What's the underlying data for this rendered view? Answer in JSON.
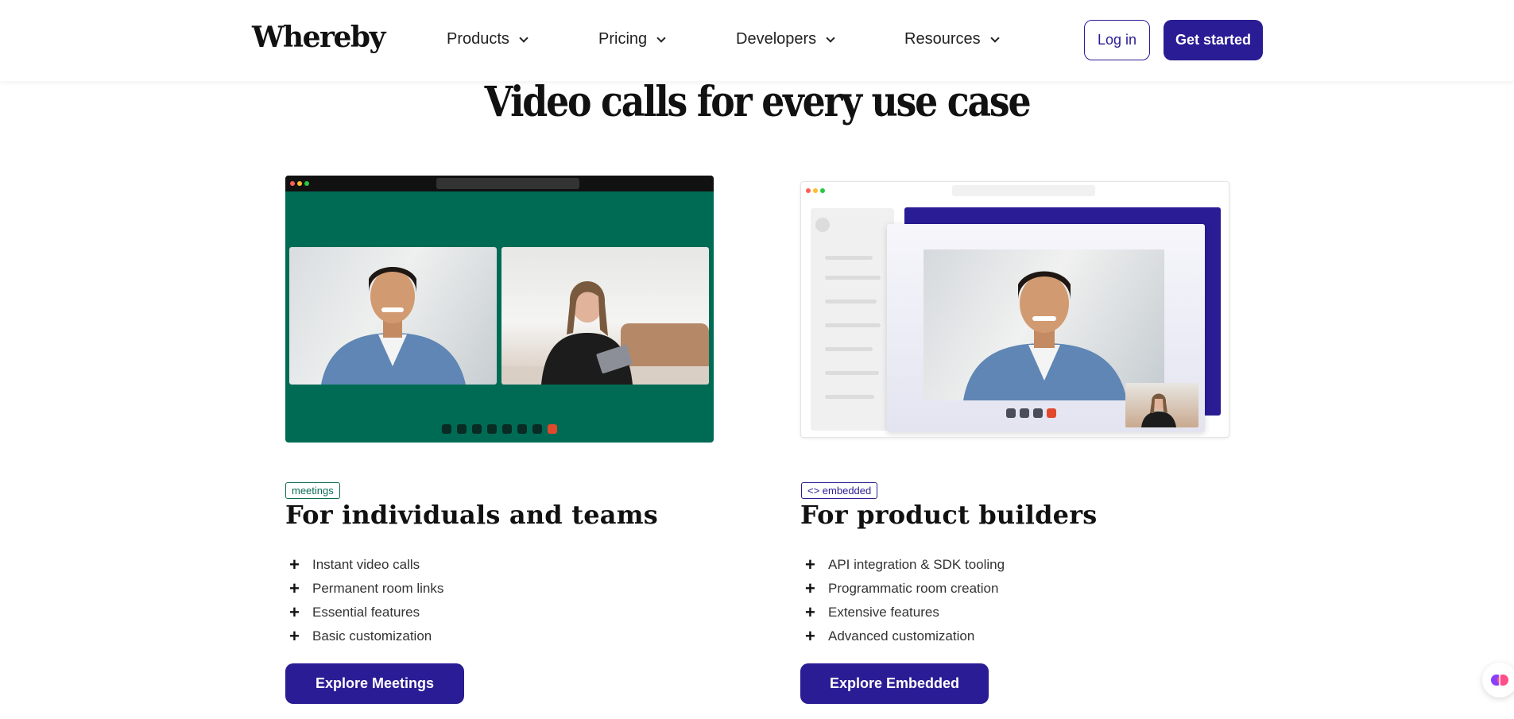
{
  "nav": {
    "logo": "Whereby",
    "items": [
      {
        "label": "Products"
      },
      {
        "label": "Pricing"
      },
      {
        "label": "Developers"
      },
      {
        "label": "Resources"
      }
    ],
    "login_label": "Log in",
    "get_started_label": "Get started"
  },
  "heading": "Video calls for every use case",
  "cards": [
    {
      "tag": "meetings",
      "title": "For individuals and teams",
      "features": [
        "Instant video calls",
        "Permanent room links",
        "Essential features",
        "Basic customization"
      ],
      "cta": "Explore Meetings"
    },
    {
      "tag": "<> embedded",
      "title": "For product builders",
      "features": [
        "API integration & SDK tooling",
        "Programmatic room creation",
        "Extensive features",
        "Advanced customization"
      ],
      "cta": "Explore Embedded"
    }
  ],
  "colors": {
    "brand_purple": "#2a1c94",
    "meetings_green": "#006b55"
  }
}
